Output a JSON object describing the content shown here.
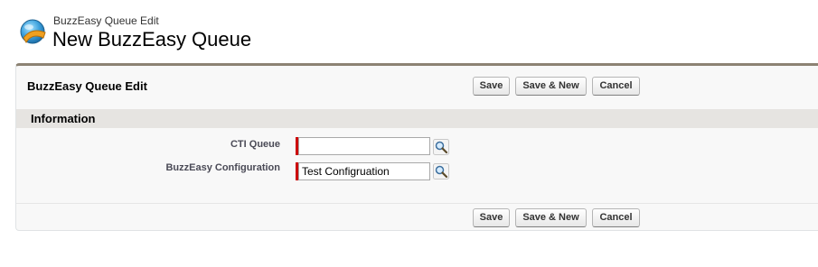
{
  "header": {
    "subtitle": "BuzzEasy Queue Edit",
    "title": "New BuzzEasy Queue",
    "icon": "buzzeasy-logo-icon"
  },
  "panel": {
    "title": "BuzzEasy Queue Edit",
    "buttons": {
      "save": "Save",
      "save_new": "Save & New",
      "cancel": "Cancel"
    }
  },
  "section": {
    "title": "Information"
  },
  "fields": [
    {
      "label": "CTI Queue",
      "value": "",
      "required": true,
      "lookup_icon": "lookup-icon"
    },
    {
      "label": "BuzzEasy Configuration",
      "value": "Test Configruation",
      "required": true,
      "lookup_icon": "lookup-icon"
    }
  ],
  "colors": {
    "panel_border": "#8c8273",
    "required": "#cc0000",
    "section_bg": "#e6e4e1"
  }
}
